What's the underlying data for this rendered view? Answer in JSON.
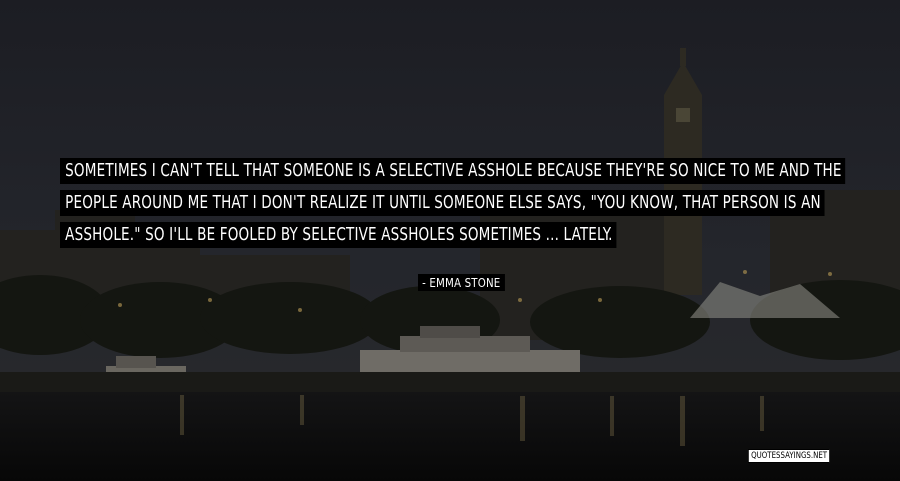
{
  "quote": {
    "lines": [
      "Sometimes I can't tell that someone is a selective asshole because they're so nice to me and the",
      "people around me that I don't realize it until someone else says, \"You know, that person is an",
      "asshole.\" So I'll be fooled by selective assholes sometimes ... lately."
    ]
  },
  "author": "- Emma Stone",
  "watermark": "quotessayings.net"
}
